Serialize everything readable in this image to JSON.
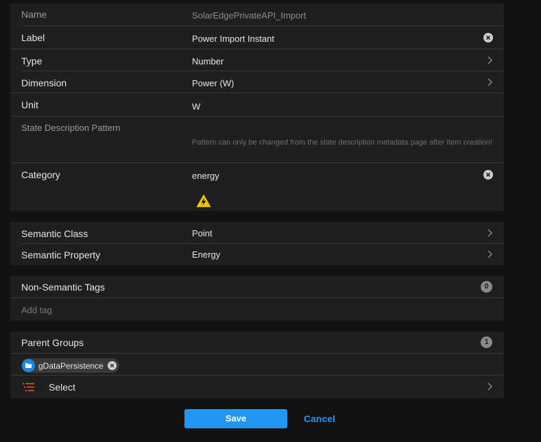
{
  "fields": {
    "name": {
      "label": "Name",
      "value": "SolarEdgePrivateAPI_Import"
    },
    "label": {
      "label": "Label",
      "value": "Power Import Instant"
    },
    "type": {
      "label": "Type",
      "value": "Number"
    },
    "dimension": {
      "label": "Dimension",
      "value": "Power (W)"
    },
    "unit": {
      "label": "Unit",
      "value": "W"
    },
    "state_pattern": {
      "label": "State Description Pattern",
      "hint": "Pattern can only be changed from the state description metadata page after Item creation!"
    },
    "category": {
      "label": "Category",
      "value": "energy",
      "icon": "warning-bolt-icon"
    }
  },
  "semantics": {
    "class": {
      "label": "Semantic Class",
      "value": "Point"
    },
    "property": {
      "label": "Semantic Property",
      "value": "Energy"
    }
  },
  "tags": {
    "label": "Non-Semantic Tags",
    "count": "0",
    "add_placeholder": "Add tag"
  },
  "groups": {
    "label": "Parent Groups",
    "count": "1",
    "chip": "gDataPersistence",
    "select_label": "Select"
  },
  "actions": {
    "save": "Save",
    "cancel": "Cancel"
  },
  "colors": {
    "accent": "#2196f3",
    "background": "#121212",
    "panel": "#1f1f1f"
  }
}
